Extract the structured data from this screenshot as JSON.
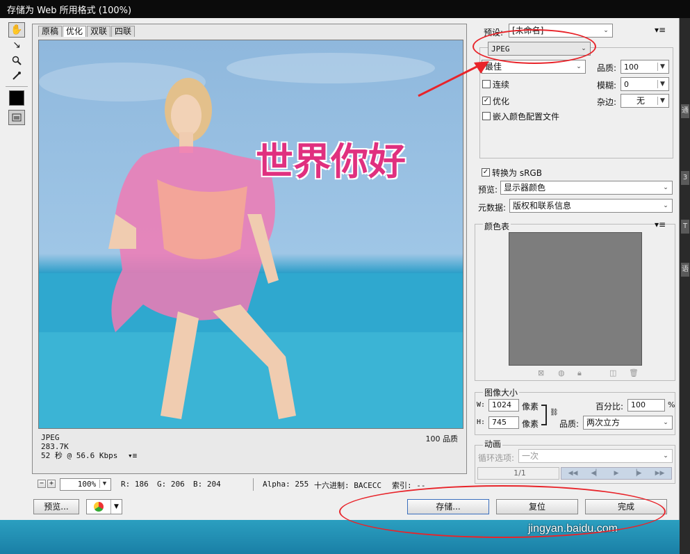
{
  "window": {
    "title": "存储为 Web 所用格式 (100%)"
  },
  "tabs": [
    {
      "label": "原稿"
    },
    {
      "label": "优化"
    },
    {
      "label": "双联"
    },
    {
      "label": "四联"
    }
  ],
  "canvas": {
    "overlay_text": "世界你好"
  },
  "preview_info": {
    "format": "JPEG",
    "size": "283.7K",
    "time": "52 秒 @ 56.6 Kbps",
    "quality": "100 品质"
  },
  "status": {
    "zoom": "100%",
    "r": "R: 186",
    "g": "G: 206",
    "b": "B: 204",
    "alpha": "Alpha: 255",
    "hex": "十六进制: BACECC",
    "index": "索引: --"
  },
  "buttons": {
    "preview": "预览...",
    "save": "存储...",
    "reset": "复位",
    "done": "完成"
  },
  "settings": {
    "preset_label": "预设:",
    "preset_value": "[未命名]",
    "format_value": "JPEG",
    "quality_preset": "最佳",
    "quality_label": "品质:",
    "quality_value": "100",
    "progressive_label": "连续",
    "blur_label": "模糊:",
    "blur_value": "0",
    "optimized_label": "优化",
    "matte_label": "杂边:",
    "matte_value": "无",
    "embed_profile_label": "嵌入颜色配置文件",
    "convert_srgb_label": "转换为 sRGB",
    "preview_label": "预览:",
    "preview_value": "显示器颜色",
    "metadata_label": "元数据:",
    "metadata_value": "版权和联系信息"
  },
  "color_table": {
    "title": "颜色表"
  },
  "image_size": {
    "title": "图像大小",
    "w_label": "W:",
    "w_value": "1024",
    "h_label": "H:",
    "h_value": "745",
    "unit": "像素",
    "percent_label": "百分比:",
    "percent_value": "100",
    "percent_unit": "%",
    "quality_label": "品质:",
    "quality_value": "两次立方"
  },
  "animation": {
    "title": "动画",
    "loop_label": "循环选项:",
    "loop_value": "一次",
    "frame": "1/1"
  },
  "side_tabs": [
    "3",
    "通",
    "T",
    "语"
  ],
  "watermark": "jingyan.baidu.com",
  "colors": {
    "annotation": "#e8242a",
    "overlay_text": "#e0307f"
  }
}
